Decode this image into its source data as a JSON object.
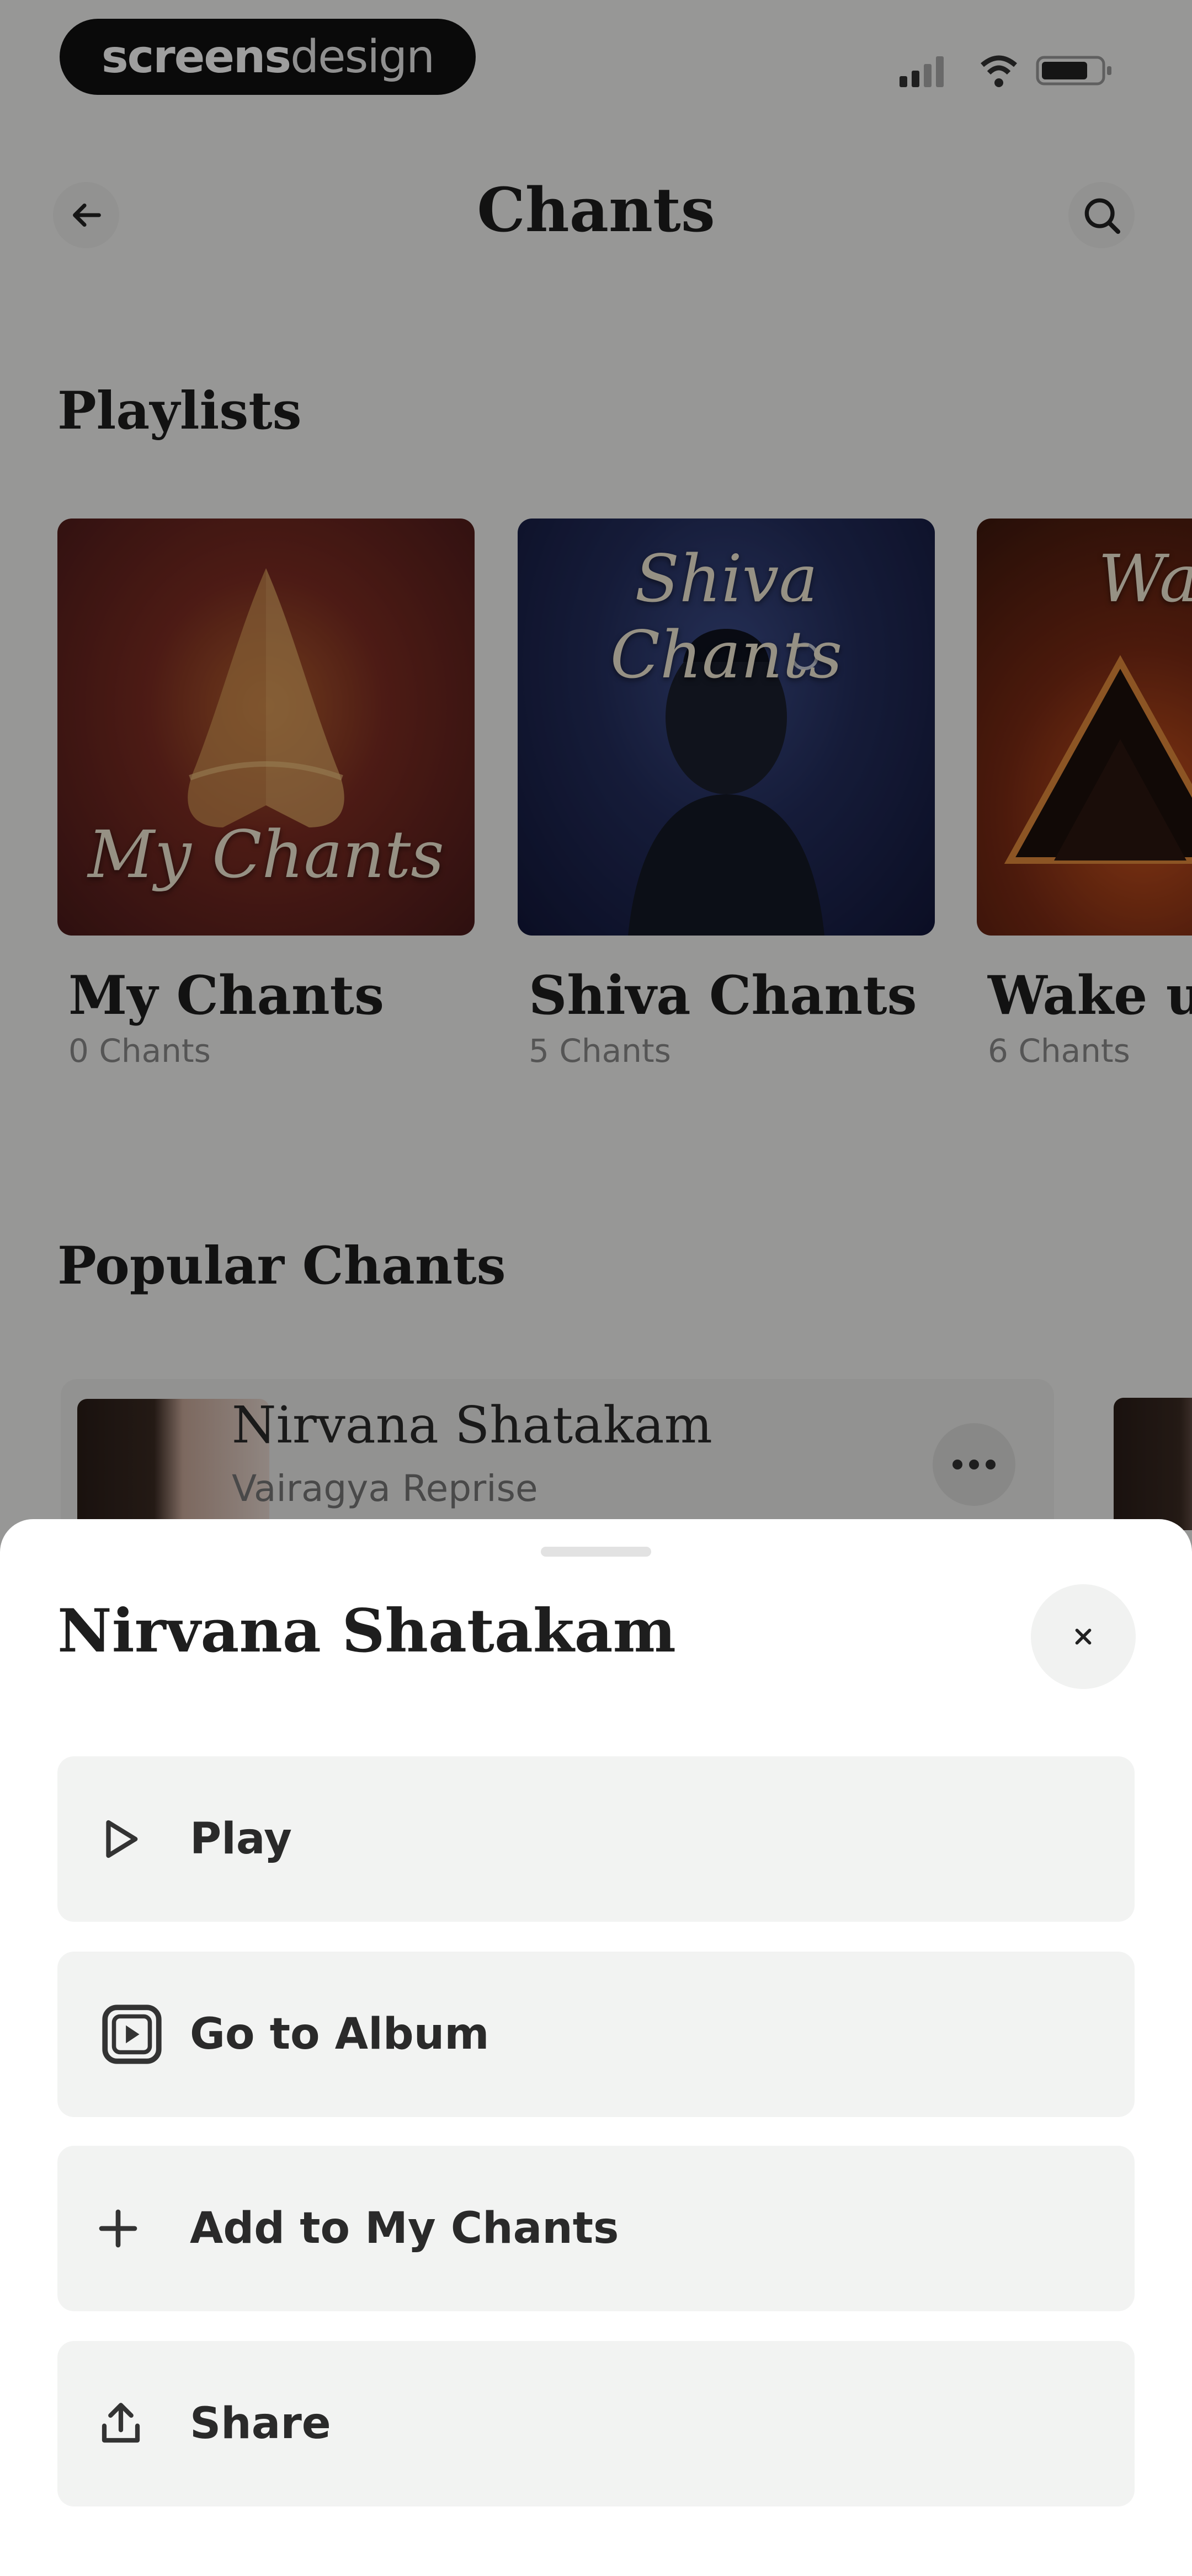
{
  "status_bar": {
    "brand_bold": "screens",
    "brand_light": "design"
  },
  "header": {
    "title": "Chants",
    "back_icon": "arrow-left-icon",
    "search_icon": "search-icon"
  },
  "playlists": {
    "section_title": "Playlists",
    "items": [
      {
        "cover_text": "My Chants",
        "name": "My Chants",
        "count": "0 Chants"
      },
      {
        "cover_text": "Shiva Chants",
        "name": "Shiva Chants",
        "count": "5 Chants"
      },
      {
        "cover_text": "Wa",
        "name": "Wake up",
        "count": "6 Chants"
      }
    ]
  },
  "popular": {
    "section_title": "Popular Chants",
    "items": [
      {
        "title": "Nirvana Shatakam",
        "subtitle": "Vairagya Reprise"
      }
    ]
  },
  "sheet": {
    "title": "Nirvana Shatakam",
    "close_icon": "close-icon",
    "actions": [
      {
        "label": "Play",
        "icon": "play-icon"
      },
      {
        "label": "Go to Album",
        "icon": "album-icon"
      },
      {
        "label": "Add to My Chants",
        "icon": "plus-icon"
      },
      {
        "label": "Share",
        "icon": "share-icon"
      }
    ]
  },
  "colors": {
    "background": "#f4f4f2",
    "sheet": "#ffffff",
    "action_bg": "#f2f3f2",
    "text": "#1e1e1e"
  }
}
